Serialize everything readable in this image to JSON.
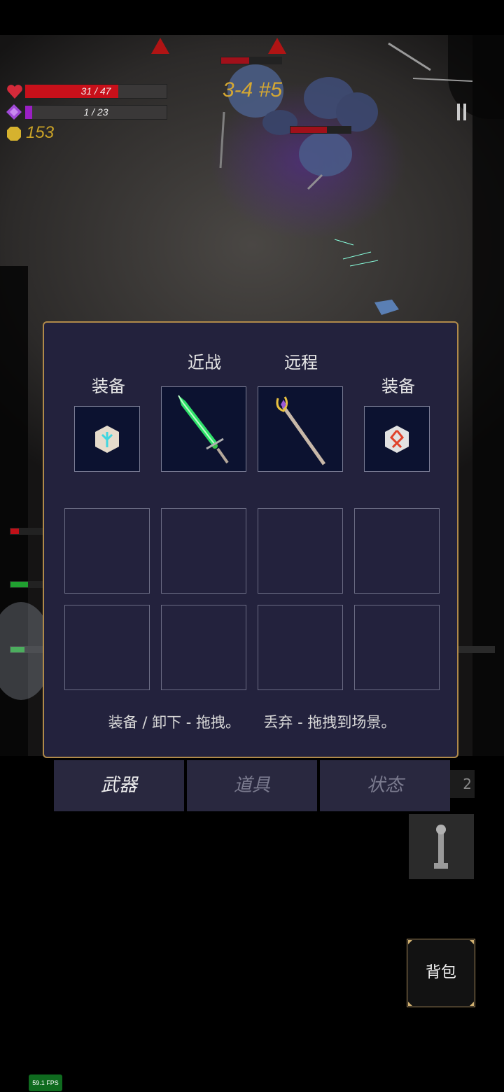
{
  "hud": {
    "health": {
      "text": "31 / 47",
      "current": 31,
      "max": 47
    },
    "mana": {
      "text": "1 / 23",
      "current": 1,
      "max": 23
    },
    "gold": "153",
    "stage": "3-4 #5"
  },
  "inventory": {
    "left_equip_label": "装备",
    "melee_label": "近战",
    "ranged_label": "远程",
    "right_equip_label": "装备",
    "hint_equip": "装备 / 卸下 - 拖拽。",
    "hint_drop": "丢弃 - 拖拽到场景。"
  },
  "tabs": {
    "weapons": "武器",
    "items": "道具",
    "status": "状态"
  },
  "side": {
    "count": "2"
  },
  "bag_button": "背包",
  "fps": "59.1 FPS",
  "colors": {
    "health": "#c8101a",
    "mana": "#9a1fc4",
    "gold": "#c9a227",
    "panel_border": "#b08a4a"
  }
}
